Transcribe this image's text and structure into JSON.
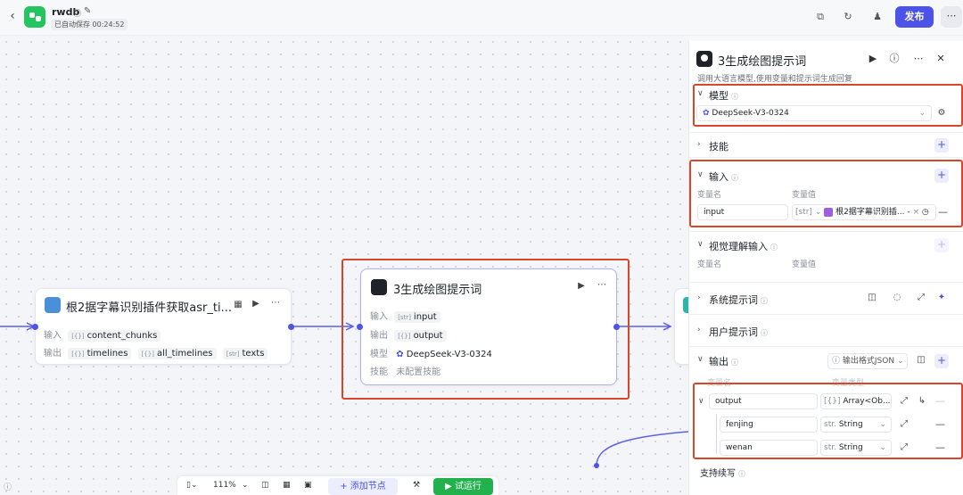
{
  "header": {
    "app_name": "rwdb",
    "autosave": "已自动保存 00:24:52",
    "publish_label": "发布"
  },
  "nodes": {
    "left": {
      "title": "根2据字幕识别插件获取asr_ti...",
      "input_label": "输入",
      "input_value": "content_chunks",
      "input_tag": "[{}]",
      "output_label": "输出",
      "outputs": [
        {
          "tag": "[{}]",
          "name": "timelines"
        },
        {
          "tag": "[{}]",
          "name": "all_timelines"
        },
        {
          "tag": "[str]",
          "name": "texts"
        }
      ]
    },
    "center": {
      "title": "3生成绘图提示词",
      "input_label": "输入",
      "input_tag": "[str]",
      "input_value": "input",
      "output_label": "输出",
      "output_tag": "[{}]",
      "output_value": "output",
      "model_label": "模型",
      "model_value": "DeepSeek-V3-0324",
      "skill_label": "技能",
      "skill_value": "未配置技能"
    }
  },
  "panel": {
    "title": "3生成绘图提示词",
    "description": "调用大语言模型,使用变量和提示词生成回复",
    "model_section": "模型",
    "model_value": "DeepSeek-V3-0324",
    "skills_section": "技能",
    "input_section": "输入",
    "var_name_label": "变量名",
    "var_value_label": "变量值",
    "input_var_name": "input",
    "input_var_type": "[str]",
    "input_var_ref": "根2据字幕识别插...",
    "input_var_ref_suffix": "-",
    "vision_section": "视觉理解输入",
    "vision_var_name_label": "变量名",
    "vision_var_value_label": "变量值",
    "system_prompt_section": "系统提示词",
    "user_prompt_section": "用户提示词",
    "output_section": "输出",
    "output_format": "输出格式JSON",
    "out_col_name": "变量名",
    "out_col_type": "变量类型",
    "outputs": [
      {
        "name": "output",
        "type": "Array<Ob..."
      },
      {
        "name": "fenjing",
        "type": "String",
        "type_tag": "str."
      },
      {
        "name": "wenan",
        "type": "String",
        "type_tag": "str."
      }
    ],
    "output_array_tag": "[{}]",
    "streaming_label": "支持续写"
  },
  "bottom_toolbar": {
    "zoom": "111%",
    "add_node": "添加节点",
    "run": "试运行"
  },
  "colors": {
    "accent": "#4d53e8",
    "run_green": "#22b14c",
    "highlight_red": "#d9472b"
  }
}
